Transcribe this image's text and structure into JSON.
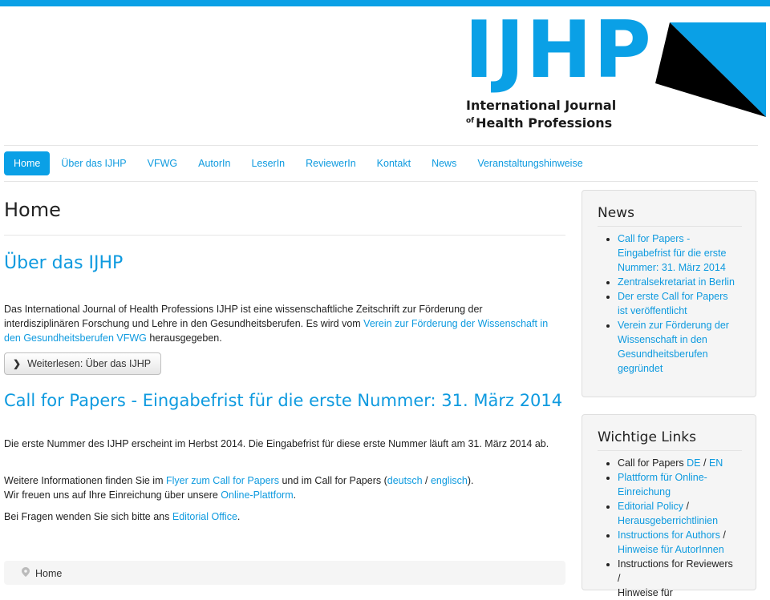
{
  "logo": {
    "letters": "IJHP",
    "line1": "International Journal",
    "of": "of",
    "line2": "Health Professions"
  },
  "nav": {
    "items": [
      {
        "label": "Home",
        "active": true
      },
      {
        "label": "Über das IJHP"
      },
      {
        "label": "VFWG"
      },
      {
        "label": "AutorIn"
      },
      {
        "label": "LeserIn"
      },
      {
        "label": "ReviewerIn"
      },
      {
        "label": "Kontakt"
      },
      {
        "label": "News"
      },
      {
        "label": "Veranstaltungshinweise"
      }
    ]
  },
  "main": {
    "title": "Home",
    "about": {
      "heading": "Über das IJHP",
      "text_before": "Das  International Journal of Health Professions IJHP ist eine wissenschaftliche Zeitschrift zur Förderung der interdisziplinären Forschung und Lehre in den Gesundheitsberufen. Es wird vom ",
      "link": "Verein zur Förderung der Wissenschaft in den Gesundheitsberufen VFWG",
      "text_after": " herausgegeben.",
      "button": "Weiterlesen: Über das IJHP"
    },
    "cfp": {
      "heading": "Call for Papers - Eingabefrist für die erste Nummer: 31. März 2014",
      "p1": "Die erste Nummer des IJHP erscheint im Herbst 2014. Die Eingabefrist für diese erste Nummer läuft am 31. März 2014 ab.",
      "p2_a": "Weitere Informationen finden Sie im ",
      "p2_link1": "Flyer zum Call for Papers",
      "p2_b": " und im Call for Papers (",
      "p2_link2": "deutsch",
      "p2_c": " / ",
      "p2_link3": "englisch",
      "p2_d": ").",
      "p3_a": "Wir freuen uns auf Ihre Einreichung über unsere ",
      "p3_link": "Online-Plattform",
      "p3_b": ".",
      "p4_a": "Bei Fragen wenden Sie sich bitte ans ",
      "p4_link": "Editorial Office",
      "p4_b": "."
    },
    "breadcrumb": "Home"
  },
  "sidebar": {
    "news": {
      "title": "News",
      "items": [
        "Call for Papers - Eingabefrist für die erste Nummer: 31. März 2014",
        "Zentralsekretariat in Berlin",
        "Der erste Call for Papers ist veröffentlicht",
        "Verein zur Förderung der Wissenschaft in den Gesundheitsberufen gegründet"
      ]
    },
    "links": {
      "title": "Wichtige Links",
      "cfp_text": "Call for Papers ",
      "cfp_de": "DE",
      "cfp_sep": " / ",
      "cfp_en": "EN",
      "platform": "Plattform für Online-Einreichung",
      "editorial_policy": "Editorial Policy",
      "slash": " /",
      "guidelines": "Herausgeberrichtlinien",
      "instr_authors": "Instructions for Authors",
      "hints_authors": "Hinweise für AutorInnen",
      "instr_reviewers": "Instructions for Reviewers /",
      "hints_reviewers": "Hinweise für"
    }
  },
  "colors": {
    "accent": "#0aa0e6",
    "link": "#0e9adf",
    "logo_black": "#000000"
  }
}
